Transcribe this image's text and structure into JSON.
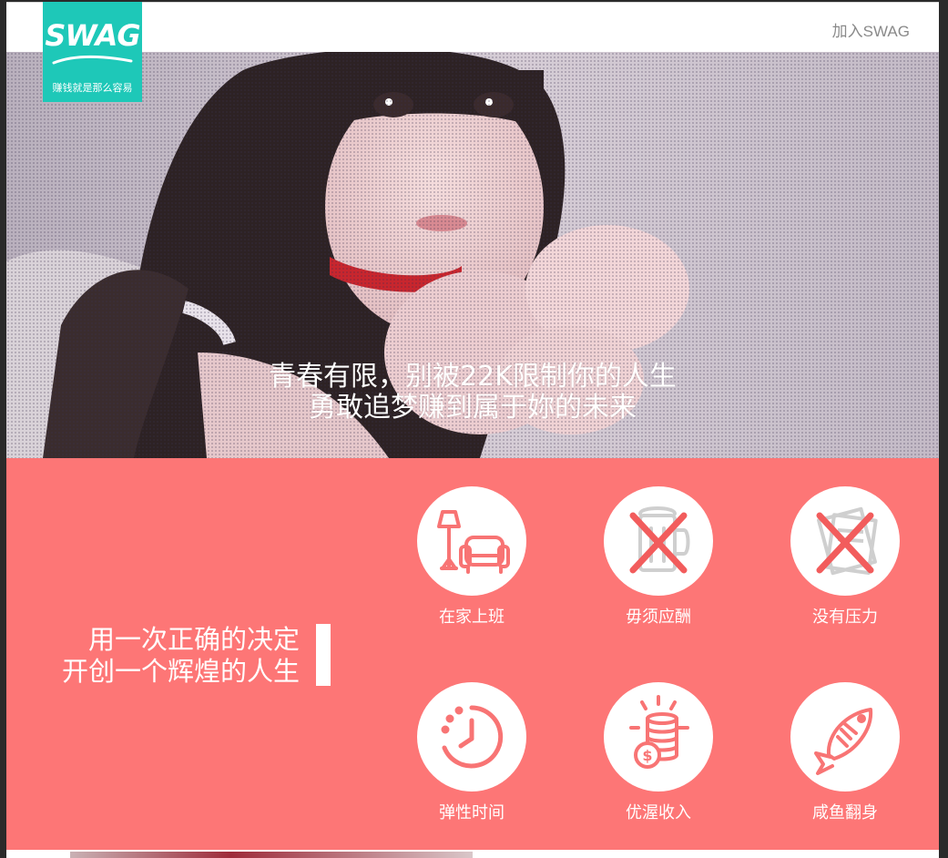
{
  "header": {
    "logo_mark": "SWAG",
    "logo_tagline": "赚钱就是那么容易",
    "join_link": "加入SWAG"
  },
  "hero": {
    "line1": "青春有限，别被22K限制你的人生",
    "line2": "勇敢追梦赚到属于妳的未来"
  },
  "slogan": {
    "line1": "用一次正确的决定",
    "line2": "开创一个辉煌的人生"
  },
  "features": [
    {
      "label": "在家上班",
      "icon": "lamp-sofa-icon"
    },
    {
      "label": "毋须应酬",
      "icon": "no-beer-icon"
    },
    {
      "label": "没有压力",
      "icon": "no-paperwork-icon"
    },
    {
      "label": "弹性时间",
      "icon": "clock-icon"
    },
    {
      "label": "优渥收入",
      "icon": "coin-stack-icon"
    },
    {
      "label": "咸鱼翻身",
      "icon": "fish-icon"
    }
  ],
  "colors": {
    "brand_teal": "#1ec8b8",
    "coral": "#fd7676",
    "icon_coral": "#f87474",
    "cross_red": "#f25c5c",
    "muted_gray": "#8a8a8a"
  }
}
